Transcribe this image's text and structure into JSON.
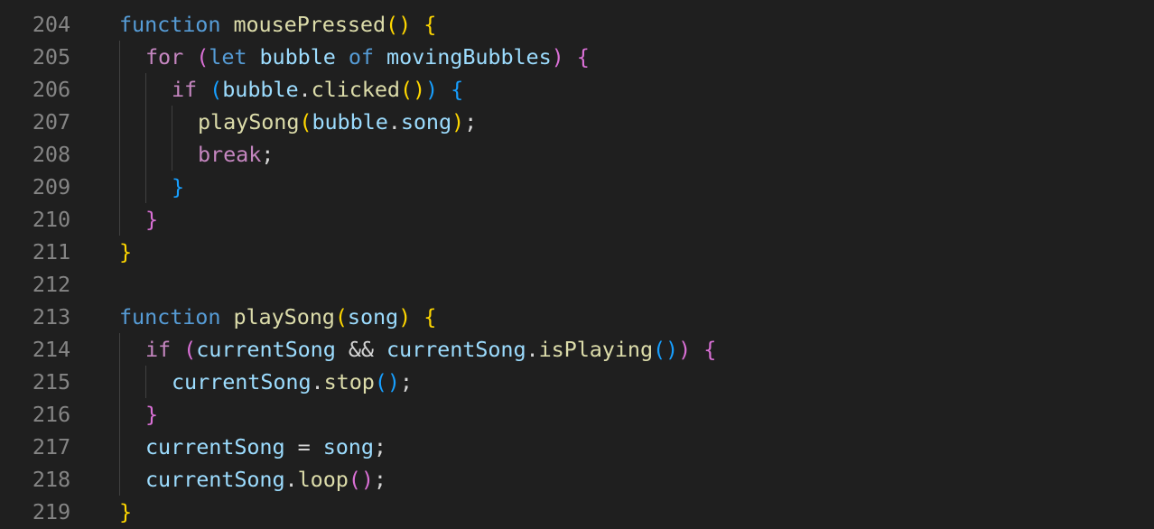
{
  "editor": {
    "lines": [
      {
        "number": "204",
        "indent": 0,
        "tokens": [
          {
            "text": "function",
            "type": "keyword"
          },
          {
            "text": " ",
            "type": "punct"
          },
          {
            "text": "mousePressed",
            "type": "function"
          },
          {
            "text": "()",
            "type": "brace1"
          },
          {
            "text": " ",
            "type": "punct"
          },
          {
            "text": "{",
            "type": "brace1"
          }
        ]
      },
      {
        "number": "205",
        "indent": 1,
        "tokens": [
          {
            "text": "for",
            "type": "control"
          },
          {
            "text": " ",
            "type": "punct"
          },
          {
            "text": "(",
            "type": "brace2"
          },
          {
            "text": "let",
            "type": "keyword"
          },
          {
            "text": " ",
            "type": "punct"
          },
          {
            "text": "bubble",
            "type": "variable"
          },
          {
            "text": " ",
            "type": "punct"
          },
          {
            "text": "of",
            "type": "keyword"
          },
          {
            "text": " ",
            "type": "punct"
          },
          {
            "text": "movingBubbles",
            "type": "variable"
          },
          {
            "text": ")",
            "type": "brace2"
          },
          {
            "text": " ",
            "type": "punct"
          },
          {
            "text": "{",
            "type": "brace2"
          }
        ]
      },
      {
        "number": "206",
        "indent": 2,
        "tokens": [
          {
            "text": "if",
            "type": "control"
          },
          {
            "text": " ",
            "type": "punct"
          },
          {
            "text": "(",
            "type": "brace3"
          },
          {
            "text": "bubble",
            "type": "variable"
          },
          {
            "text": ".",
            "type": "punct"
          },
          {
            "text": "clicked",
            "type": "function"
          },
          {
            "text": "()",
            "type": "brace1"
          },
          {
            "text": ")",
            "type": "brace3"
          },
          {
            "text": " ",
            "type": "punct"
          },
          {
            "text": "{",
            "type": "brace3"
          }
        ]
      },
      {
        "number": "207",
        "indent": 3,
        "tokens": [
          {
            "text": "playSong",
            "type": "function"
          },
          {
            "text": "(",
            "type": "brace1"
          },
          {
            "text": "bubble",
            "type": "variable"
          },
          {
            "text": ".",
            "type": "punct"
          },
          {
            "text": "song",
            "type": "variable"
          },
          {
            "text": ")",
            "type": "brace1"
          },
          {
            "text": ";",
            "type": "punct"
          }
        ]
      },
      {
        "number": "208",
        "indent": 3,
        "tokens": [
          {
            "text": "break",
            "type": "control"
          },
          {
            "text": ";",
            "type": "punct"
          }
        ]
      },
      {
        "number": "209",
        "indent": 2,
        "tokens": [
          {
            "text": "}",
            "type": "brace3"
          }
        ]
      },
      {
        "number": "210",
        "indent": 1,
        "tokens": [
          {
            "text": "}",
            "type": "brace2"
          }
        ]
      },
      {
        "number": "211",
        "indent": 0,
        "tokens": [
          {
            "text": "}",
            "type": "brace1"
          }
        ]
      },
      {
        "number": "212",
        "indent": 0,
        "tokens": []
      },
      {
        "number": "213",
        "indent": 0,
        "tokens": [
          {
            "text": "function",
            "type": "keyword"
          },
          {
            "text": " ",
            "type": "punct"
          },
          {
            "text": "playSong",
            "type": "function"
          },
          {
            "text": "(",
            "type": "brace1"
          },
          {
            "text": "song",
            "type": "variable"
          },
          {
            "text": ")",
            "type": "brace1"
          },
          {
            "text": " ",
            "type": "punct"
          },
          {
            "text": "{",
            "type": "brace1"
          }
        ]
      },
      {
        "number": "214",
        "indent": 1,
        "tokens": [
          {
            "text": "if",
            "type": "control"
          },
          {
            "text": " ",
            "type": "punct"
          },
          {
            "text": "(",
            "type": "brace2"
          },
          {
            "text": "currentSong",
            "type": "variable"
          },
          {
            "text": " && ",
            "type": "punct"
          },
          {
            "text": "currentSong",
            "type": "variable"
          },
          {
            "text": ".",
            "type": "punct"
          },
          {
            "text": "isPlaying",
            "type": "function"
          },
          {
            "text": "()",
            "type": "brace3"
          },
          {
            "text": ")",
            "type": "brace2"
          },
          {
            "text": " ",
            "type": "punct"
          },
          {
            "text": "{",
            "type": "brace2"
          }
        ]
      },
      {
        "number": "215",
        "indent": 2,
        "tokens": [
          {
            "text": "currentSong",
            "type": "variable"
          },
          {
            "text": ".",
            "type": "punct"
          },
          {
            "text": "stop",
            "type": "function"
          },
          {
            "text": "()",
            "type": "brace3"
          },
          {
            "text": ";",
            "type": "punct"
          }
        ]
      },
      {
        "number": "216",
        "indent": 1,
        "tokens": [
          {
            "text": "}",
            "type": "brace2"
          }
        ]
      },
      {
        "number": "217",
        "indent": 1,
        "tokens": [
          {
            "text": "currentSong",
            "type": "variable"
          },
          {
            "text": " = ",
            "type": "punct"
          },
          {
            "text": "song",
            "type": "variable"
          },
          {
            "text": ";",
            "type": "punct"
          }
        ]
      },
      {
        "number": "218",
        "indent": 1,
        "tokens": [
          {
            "text": "currentSong",
            "type": "variable"
          },
          {
            "text": ".",
            "type": "punct"
          },
          {
            "text": "loop",
            "type": "function"
          },
          {
            "text": "()",
            "type": "brace2"
          },
          {
            "text": ";",
            "type": "punct"
          }
        ]
      },
      {
        "number": "219",
        "indent": 0,
        "tokens": [
          {
            "text": "}",
            "type": "brace1"
          }
        ]
      }
    ],
    "colors": {
      "background": "#1f1f1f",
      "line_number": "#858585",
      "keyword": "#569cd6",
      "control": "#c586c0",
      "function": "#dcdcaa",
      "variable": "#9cdcfe",
      "punct": "#d4d4d4",
      "bracket_level_1": "#ffd700",
      "bracket_level_2": "#da70d6",
      "bracket_level_3": "#179fff",
      "indent_guide": "#404040"
    }
  }
}
